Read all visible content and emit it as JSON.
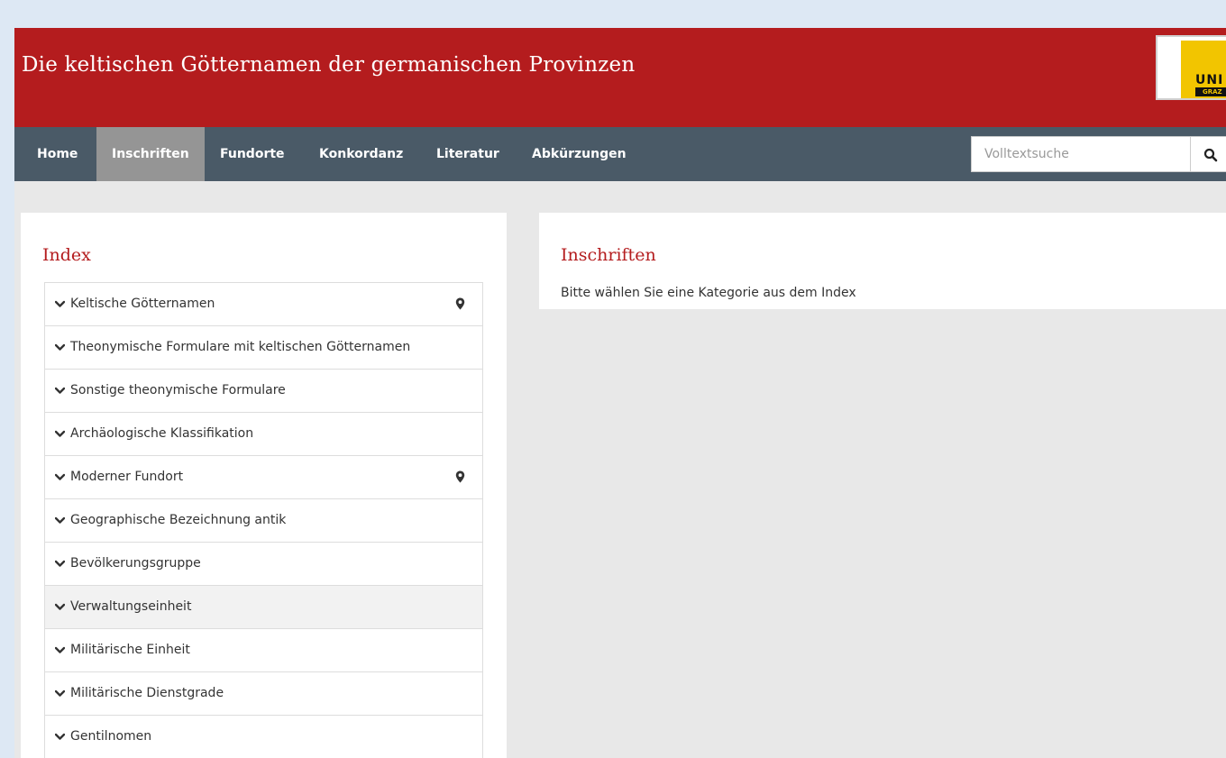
{
  "header": {
    "title": "Die keltischen Götternamen der germanischen Provinzen",
    "logo_text": "UNI",
    "logo_subtext": "GRAZ"
  },
  "nav": {
    "items": [
      {
        "label": "Home",
        "active": false
      },
      {
        "label": "Inschriften",
        "active": true
      },
      {
        "label": "Fundorte",
        "active": false
      },
      {
        "label": "Konkordanz",
        "active": false
      },
      {
        "label": "Literatur",
        "active": false
      },
      {
        "label": "Abkürzungen",
        "active": false
      }
    ],
    "search_placeholder": "Volltextsuche"
  },
  "index": {
    "heading": "Index",
    "items": [
      {
        "label": "Keltische Götternamen",
        "map_icon": true
      },
      {
        "label": "Theonymische Formulare mit keltischen Götternamen",
        "map_icon": false
      },
      {
        "label": "Sonstige theonymische Formulare",
        "map_icon": false
      },
      {
        "label": "Archäologische Klassifikation",
        "map_icon": false
      },
      {
        "label": "Moderner Fundort",
        "map_icon": true
      },
      {
        "label": "Geographische Bezeichnung antik",
        "map_icon": false
      },
      {
        "label": "Bevölkerungsgruppe",
        "map_icon": false
      },
      {
        "label": "Verwaltungseinheit",
        "map_icon": false,
        "hovered": true
      },
      {
        "label": "Militärische Einheit",
        "map_icon": false
      },
      {
        "label": "Militärische Dienstgrade",
        "map_icon": false
      },
      {
        "label": "Gentilnomen",
        "map_icon": false
      }
    ]
  },
  "content": {
    "heading": "Inschriften",
    "text": "Bitte wählen Sie eine Kategorie aus dem Index"
  },
  "colors": {
    "brand_red": "#b41c1e",
    "nav_bg": "#4a5a67",
    "nav_active": "#959595",
    "logo_yellow": "#f2c500"
  }
}
